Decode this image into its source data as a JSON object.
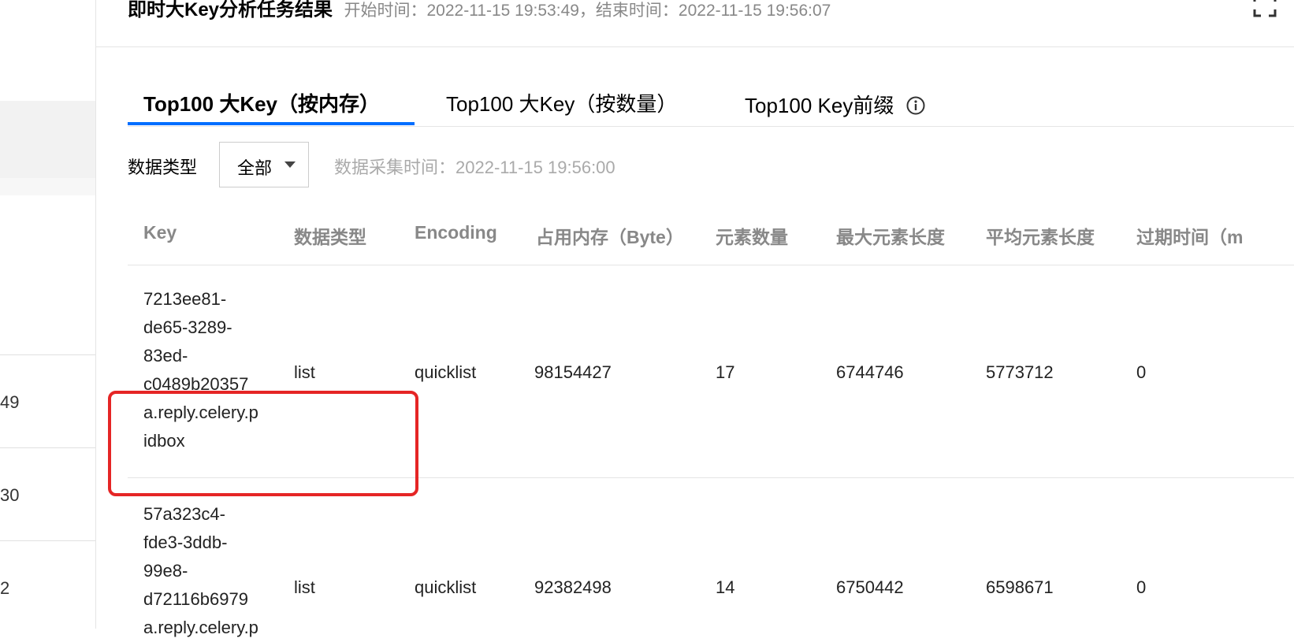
{
  "left_panel": {
    "numbers": [
      "49",
      "30",
      "2"
    ]
  },
  "header": {
    "title": "即时大Key分析任务结果",
    "time_info": "开始时间：2022-11-15 19:53:49，结束时间：2022-11-15 19:56:07"
  },
  "tabs": [
    {
      "label": "Top100 大Key（按内存）",
      "active": true
    },
    {
      "label": "Top100 大Key（按数量）",
      "active": false
    },
    {
      "label": "Top100 Key前缀",
      "active": false
    }
  ],
  "filter": {
    "label": "数据类型",
    "select_value": "全部",
    "collect_time": "数据采集时间：2022-11-15 19:56:00"
  },
  "table": {
    "columns": [
      "Key",
      "数据类型",
      "Encoding",
      "占用内存（Byte）",
      "元素数量",
      "最大元素长度",
      "平均元素长度",
      "过期时间（m"
    ],
    "rows": [
      {
        "key_lines": [
          "7213ee81-",
          "de65-3289-",
          "83ed-",
          "c0489b20357",
          "a.reply.celery.p",
          "idbox"
        ],
        "type": "list",
        "encoding": "quicklist",
        "memory": "98154427",
        "count": "17",
        "max_len": "6744746",
        "avg_len": "5773712",
        "expire": "0"
      },
      {
        "key_lines": [
          "57a323c4-",
          "fde3-3ddb-",
          "99e8-",
          "d72116b6979",
          "a.reply.celery.p"
        ],
        "type": "list",
        "encoding": "quicklist",
        "memory": "92382498",
        "count": "14",
        "max_len": "6750442",
        "avg_len": "6598671",
        "expire": "0"
      }
    ]
  },
  "colors": {
    "accent": "#006eff",
    "highlight": "#e52525",
    "muted": "#888888"
  }
}
